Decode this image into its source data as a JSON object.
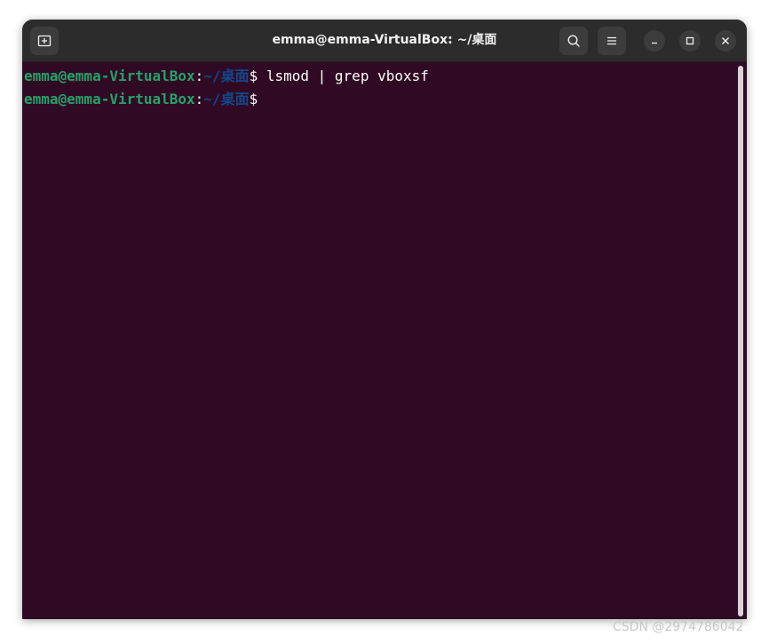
{
  "window": {
    "title": "emma@emma-VirtualBox: ~/桌面"
  },
  "toolbar": {
    "new_tab_icon": "new-tab-icon",
    "search_icon": "search-icon",
    "menu_icon": "hamburger-menu-icon",
    "minimize_icon": "minimize-icon",
    "maximize_icon": "maximize-icon",
    "close_icon": "close-icon"
  },
  "terminal": {
    "lines": [
      {
        "user_host": "emma@emma-VirtualBox",
        "colon": ":",
        "path": "~/桌面",
        "prompt_symbol": "$",
        "command": " lsmod | grep vboxsf"
      },
      {
        "user_host": "emma@emma-VirtualBox",
        "colon": ":",
        "path": "~/桌面",
        "prompt_symbol": "$",
        "command": ""
      }
    ]
  },
  "colors": {
    "terminal_background": "#300a24",
    "user_host": "#26a269",
    "path": "#12488b",
    "titlebar": "#2c2c2c"
  },
  "watermark": "CSDN @2974786042"
}
